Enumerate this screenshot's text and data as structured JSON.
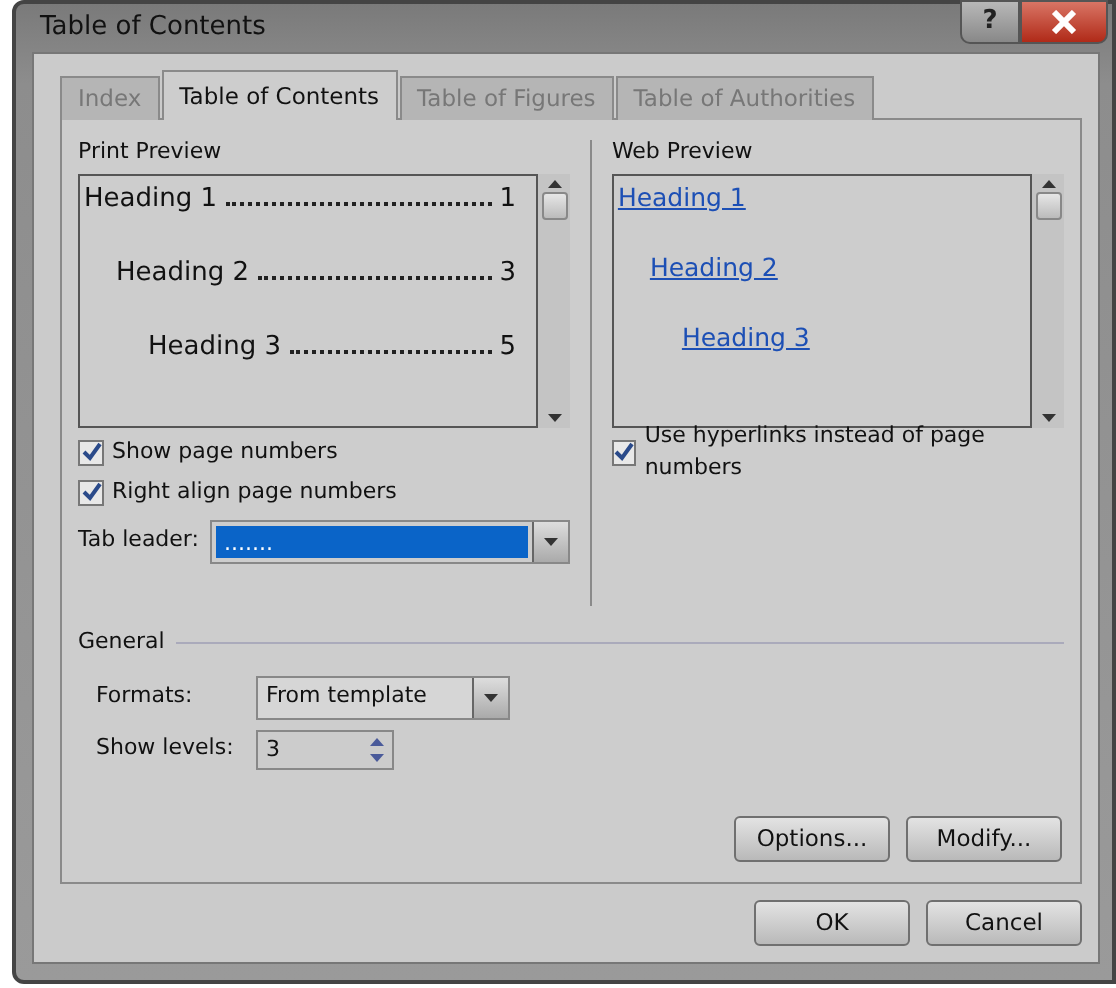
{
  "window": {
    "title": "Table of Contents",
    "help_button": "?"
  },
  "tabs": [
    {
      "label": "Index",
      "selected": false
    },
    {
      "label": "Table of Contents",
      "selected": true
    },
    {
      "label": "Table of Figures",
      "selected": false
    },
    {
      "label": "Table of Authorities",
      "selected": false
    }
  ],
  "print_preview": {
    "label": "Print Preview",
    "entries": [
      {
        "text": "Heading 1",
        "page": "1",
        "children": [
          {
            "text": "Heading 2",
            "page": "3",
            "children": [
              {
                "text": "Heading 3",
                "page": "5"
              }
            ]
          }
        ]
      }
    ],
    "checkboxes": [
      {
        "label": "Show page numbers",
        "checked": true
      },
      {
        "label": "Right align page numbers",
        "checked": true
      }
    ],
    "tab_leader": {
      "label": "Tab leader:",
      "value": "......."
    }
  },
  "web_preview": {
    "label": "Web Preview",
    "links": [
      {
        "text": "Heading 1",
        "children": [
          {
            "text": "Heading 2",
            "children": [
              {
                "text": "Heading 3"
              }
            ]
          }
        ]
      }
    ],
    "checkboxes": [
      {
        "label": "Use hyperlinks instead of page numbers",
        "checked": true
      }
    ]
  },
  "general": {
    "label": "General",
    "formats": {
      "label": "Formats:",
      "value": "From template"
    },
    "show_levels": {
      "label": "Show levels:",
      "value": "3"
    }
  },
  "panel_buttons": [
    "Options...",
    "Modify..."
  ],
  "dialog_buttons": [
    "OK",
    "Cancel"
  ]
}
